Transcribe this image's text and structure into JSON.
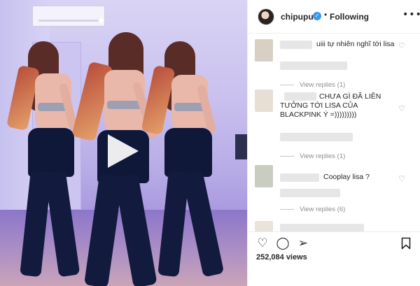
{
  "post": {
    "username": "chipupu",
    "verified_badge": "✓",
    "separator": "•",
    "follow_status": "Following",
    "more_icon": "•••"
  },
  "comments": [
    {
      "avatar_color": "#d8d0c3",
      "text": "uiii tự nhiên nghĩ tới lisa",
      "view_replies": "View replies (1)"
    },
    {
      "avatar_color": "#e7dfd3",
      "text": "CHƯA GÌ ĐÃ LIÊN TƯỞNG TỚI LISA CỦA BLACKPINK Ý =)))))))))",
      "view_replies": "View replies (1)"
    },
    {
      "avatar_color": "#c8ccc1",
      "text": "Cooplay lisa ?",
      "view_replies": "View replies (6)"
    }
  ],
  "actions": {
    "like_icon": "heart-outline-icon",
    "comment_icon": "comment-bubble-icon",
    "share_icon": "paper-plane-icon",
    "save_icon": "bookmark-icon"
  },
  "views": "252,084 views",
  "colors": {
    "verified_blue": "#3897f0",
    "muted_text": "#8e8e8e",
    "border": "#efefef"
  }
}
